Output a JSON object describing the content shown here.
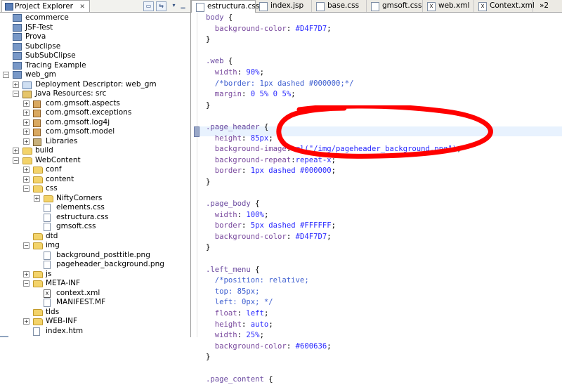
{
  "explorer": {
    "title": "Project Explorer",
    "close": "✕",
    "items": [
      {
        "label": "ecommerce",
        "icon": "project",
        "depth": 0,
        "expander": ""
      },
      {
        "label": "JSF-Test",
        "icon": "project",
        "depth": 0,
        "expander": ""
      },
      {
        "label": "Prova",
        "icon": "project",
        "depth": 0,
        "expander": ""
      },
      {
        "label": "Subclipse",
        "icon": "project",
        "depth": 0,
        "expander": ""
      },
      {
        "label": "SubSubClipse",
        "icon": "project",
        "depth": 0,
        "expander": ""
      },
      {
        "label": "Tracing Example",
        "icon": "project",
        "depth": 0,
        "expander": ""
      },
      {
        "label": "web_gm",
        "icon": "project",
        "depth": 0,
        "expander": "−"
      },
      {
        "label": "Deployment Descriptor: web_gm",
        "icon": "dd",
        "depth": 1,
        "expander": "+"
      },
      {
        "label": "Java Resources: src",
        "icon": "src",
        "depth": 1,
        "expander": "−"
      },
      {
        "label": "com.gmsoft.aspects",
        "icon": "package",
        "depth": 2,
        "expander": "+"
      },
      {
        "label": "com.gmsoft.exceptions",
        "icon": "package",
        "depth": 2,
        "expander": "+"
      },
      {
        "label": "com.gmsoft.log4j",
        "icon": "package",
        "depth": 2,
        "expander": "+"
      },
      {
        "label": "com.gmsoft.model",
        "icon": "package",
        "depth": 2,
        "expander": "+"
      },
      {
        "label": "Libraries",
        "icon": "jar",
        "depth": 2,
        "expander": "+"
      },
      {
        "label": "build",
        "icon": "folder",
        "depth": 1,
        "expander": "+"
      },
      {
        "label": "WebContent",
        "icon": "folder",
        "depth": 1,
        "expander": "−"
      },
      {
        "label": "conf",
        "icon": "folder",
        "depth": 2,
        "expander": "+"
      },
      {
        "label": "content",
        "icon": "folder",
        "depth": 2,
        "expander": "+"
      },
      {
        "label": "css",
        "icon": "folder",
        "depth": 2,
        "expander": "−"
      },
      {
        "label": "NiftyCorners",
        "icon": "folder",
        "depth": 3,
        "expander": "+"
      },
      {
        "label": "elements.css",
        "icon": "file",
        "depth": 3,
        "expander": ""
      },
      {
        "label": "estructura.css",
        "icon": "file",
        "depth": 3,
        "expander": ""
      },
      {
        "label": "gmsoft.css",
        "icon": "file",
        "depth": 3,
        "expander": ""
      },
      {
        "label": "dtd",
        "icon": "folder",
        "depth": 2,
        "expander": ""
      },
      {
        "label": "img",
        "icon": "folder",
        "depth": 2,
        "expander": "−"
      },
      {
        "label": "background_posttitle.png",
        "icon": "file",
        "depth": 3,
        "expander": ""
      },
      {
        "label": "pageheader_background.png",
        "icon": "file",
        "depth": 3,
        "expander": ""
      },
      {
        "label": "js",
        "icon": "folder",
        "depth": 2,
        "expander": "+"
      },
      {
        "label": "META-INF",
        "icon": "folder",
        "depth": 2,
        "expander": "−"
      },
      {
        "label": "context.xml",
        "icon": "xml",
        "depth": 3,
        "expander": ""
      },
      {
        "label": "MANIFEST.MF",
        "icon": "file",
        "depth": 3,
        "expander": ""
      },
      {
        "label": "tlds",
        "icon": "folder",
        "depth": 2,
        "expander": ""
      },
      {
        "label": "WEB-INF",
        "icon": "folder",
        "depth": 2,
        "expander": "+"
      },
      {
        "label": "index.htm",
        "icon": "file",
        "depth": 2,
        "expander": ""
      }
    ]
  },
  "editor": {
    "tabs": [
      {
        "label": "estructura.css",
        "active": true,
        "close": "✕",
        "icon": "css"
      },
      {
        "label": "index.jsp",
        "active": false,
        "icon": "jsp"
      },
      {
        "label": "base.css",
        "active": false,
        "icon": "css"
      },
      {
        "label": "gmsoft.css",
        "active": false,
        "icon": "css"
      },
      {
        "label": "web.xml",
        "active": false,
        "icon": "xml"
      },
      {
        "label": "Context.xml",
        "active": false,
        "icon": "xml"
      }
    ],
    "overflow": "»2",
    "code_lines": [
      [
        [
          "sel",
          "body "
        ],
        [
          "punc",
          "{"
        ]
      ],
      [
        [
          "prop",
          "  background-color"
        ],
        [
          "punc",
          ": "
        ],
        [
          "val",
          "#D4F7D7"
        ],
        [
          "punc",
          ";"
        ]
      ],
      [
        [
          "punc",
          "}"
        ]
      ],
      [],
      [
        [
          "sel",
          ".web "
        ],
        [
          "punc",
          "{"
        ]
      ],
      [
        [
          "prop",
          "  width"
        ],
        [
          "punc",
          ": "
        ],
        [
          "val",
          "90%"
        ],
        [
          "punc",
          ";"
        ]
      ],
      [
        [
          "cmt",
          "  /*border: 1px dashed #000000;*/"
        ]
      ],
      [
        [
          "prop",
          "  margin"
        ],
        [
          "punc",
          ": "
        ],
        [
          "val",
          "0 5% 0 5%"
        ],
        [
          "punc",
          ";"
        ]
      ],
      [
        [
          "punc",
          "}"
        ]
      ],
      [],
      [
        [
          "sel",
          ".page_header "
        ],
        [
          "punc",
          "{"
        ]
      ],
      [
        [
          "prop",
          "  height"
        ],
        [
          "punc",
          ": "
        ],
        [
          "val",
          "85px"
        ],
        [
          "punc",
          ";"
        ]
      ],
      [
        [
          "prop",
          "  background-image"
        ],
        [
          "punc",
          ":"
        ],
        [
          "val",
          "url(\"/img/pageheader_background.png\")"
        ],
        [
          "punc",
          ";"
        ]
      ],
      [
        [
          "prop",
          "  background-repeat"
        ],
        [
          "punc",
          ":"
        ],
        [
          "val",
          "repeat-x"
        ],
        [
          "punc",
          ";"
        ]
      ],
      [
        [
          "prop",
          "  border"
        ],
        [
          "punc",
          ": "
        ],
        [
          "val",
          "1px dashed #000000"
        ],
        [
          "punc",
          ";"
        ]
      ],
      [
        [
          "punc",
          "}"
        ]
      ],
      [],
      [
        [
          "sel",
          ".page_body "
        ],
        [
          "punc",
          "{"
        ]
      ],
      [
        [
          "prop",
          "  width"
        ],
        [
          "punc",
          ": "
        ],
        [
          "val",
          "100%"
        ],
        [
          "punc",
          ";"
        ]
      ],
      [
        [
          "prop",
          "  border"
        ],
        [
          "punc",
          ": "
        ],
        [
          "val",
          "5px dashed #FFFFFF"
        ],
        [
          "punc",
          ";"
        ]
      ],
      [
        [
          "prop",
          "  background-color"
        ],
        [
          "punc",
          ": "
        ],
        [
          "val",
          "#D4F7D7"
        ],
        [
          "punc",
          ";"
        ]
      ],
      [
        [
          "punc",
          "}"
        ]
      ],
      [],
      [
        [
          "sel",
          ".left_menu "
        ],
        [
          "punc",
          "{"
        ]
      ],
      [
        [
          "cmt",
          "  /*position: relative;"
        ]
      ],
      [
        [
          "cmt",
          "  top: 85px;"
        ]
      ],
      [
        [
          "cmt",
          "  left: 0px; */"
        ]
      ],
      [
        [
          "prop",
          "  float"
        ],
        [
          "punc",
          ": "
        ],
        [
          "val",
          "left"
        ],
        [
          "punc",
          ";"
        ]
      ],
      [
        [
          "prop",
          "  height"
        ],
        [
          "punc",
          ": "
        ],
        [
          "val",
          "auto"
        ],
        [
          "punc",
          ";"
        ]
      ],
      [
        [
          "prop",
          "  width"
        ],
        [
          "punc",
          ": "
        ],
        [
          "val",
          "25%"
        ],
        [
          "punc",
          ";"
        ]
      ],
      [
        [
          "prop",
          "  background-color"
        ],
        [
          "punc",
          ": "
        ],
        [
          "val",
          "#600636"
        ],
        [
          "punc",
          ";"
        ]
      ],
      [
        [
          "punc",
          "}"
        ]
      ],
      [],
      [
        [
          "sel",
          ".page_content "
        ],
        [
          "punc",
          "{"
        ]
      ]
    ]
  },
  "colors": {
    "annotation": "#ff0000",
    "current_line": "#e8f2fe"
  }
}
